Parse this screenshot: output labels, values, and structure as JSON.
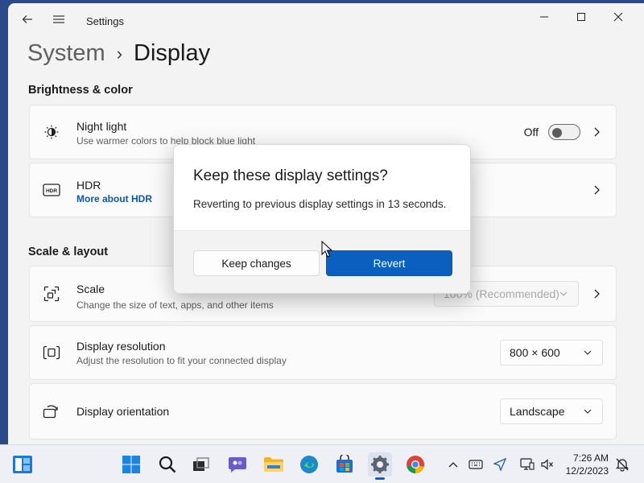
{
  "window": {
    "app_title": "Settings",
    "breadcrumb": {
      "parent": "System",
      "separator": "›",
      "current": "Display"
    }
  },
  "sections": {
    "brightness_color": "Brightness & color",
    "scale_layout": "Scale & layout"
  },
  "night_light": {
    "title": "Night light",
    "subtitle": "Use warmer colors to help block blue light",
    "state_label": "Off",
    "toggle_on": false
  },
  "hdr": {
    "title": "HDR",
    "link": "More about HDR"
  },
  "scale": {
    "title": "Scale",
    "subtitle": "Change the size of text, apps, and other items",
    "value": "100% (Recommended)"
  },
  "resolution": {
    "title": "Display resolution",
    "subtitle": "Adjust the resolution to fit your connected display",
    "value": "800 × 600"
  },
  "orientation": {
    "title": "Display orientation",
    "value": "Landscape"
  },
  "dialog": {
    "title": "Keep these display settings?",
    "message": "Reverting to previous display settings in 13 seconds.",
    "keep_label": "Keep changes",
    "revert_label": "Revert"
  },
  "taskbar": {
    "time": "7:26 AM",
    "date": "12/2/2023",
    "icons": [
      "widgets-icon",
      "start-icon",
      "search-icon",
      "task-view-icon",
      "chat-icon",
      "file-explorer-icon",
      "edge-icon",
      "store-icon",
      "settings-icon",
      "chrome-icon"
    ]
  },
  "colors": {
    "accent": "#0a5fbf",
    "window_bg": "#f3f3f3",
    "card_bg": "#fbfbfb",
    "link": "#0b57a8"
  }
}
